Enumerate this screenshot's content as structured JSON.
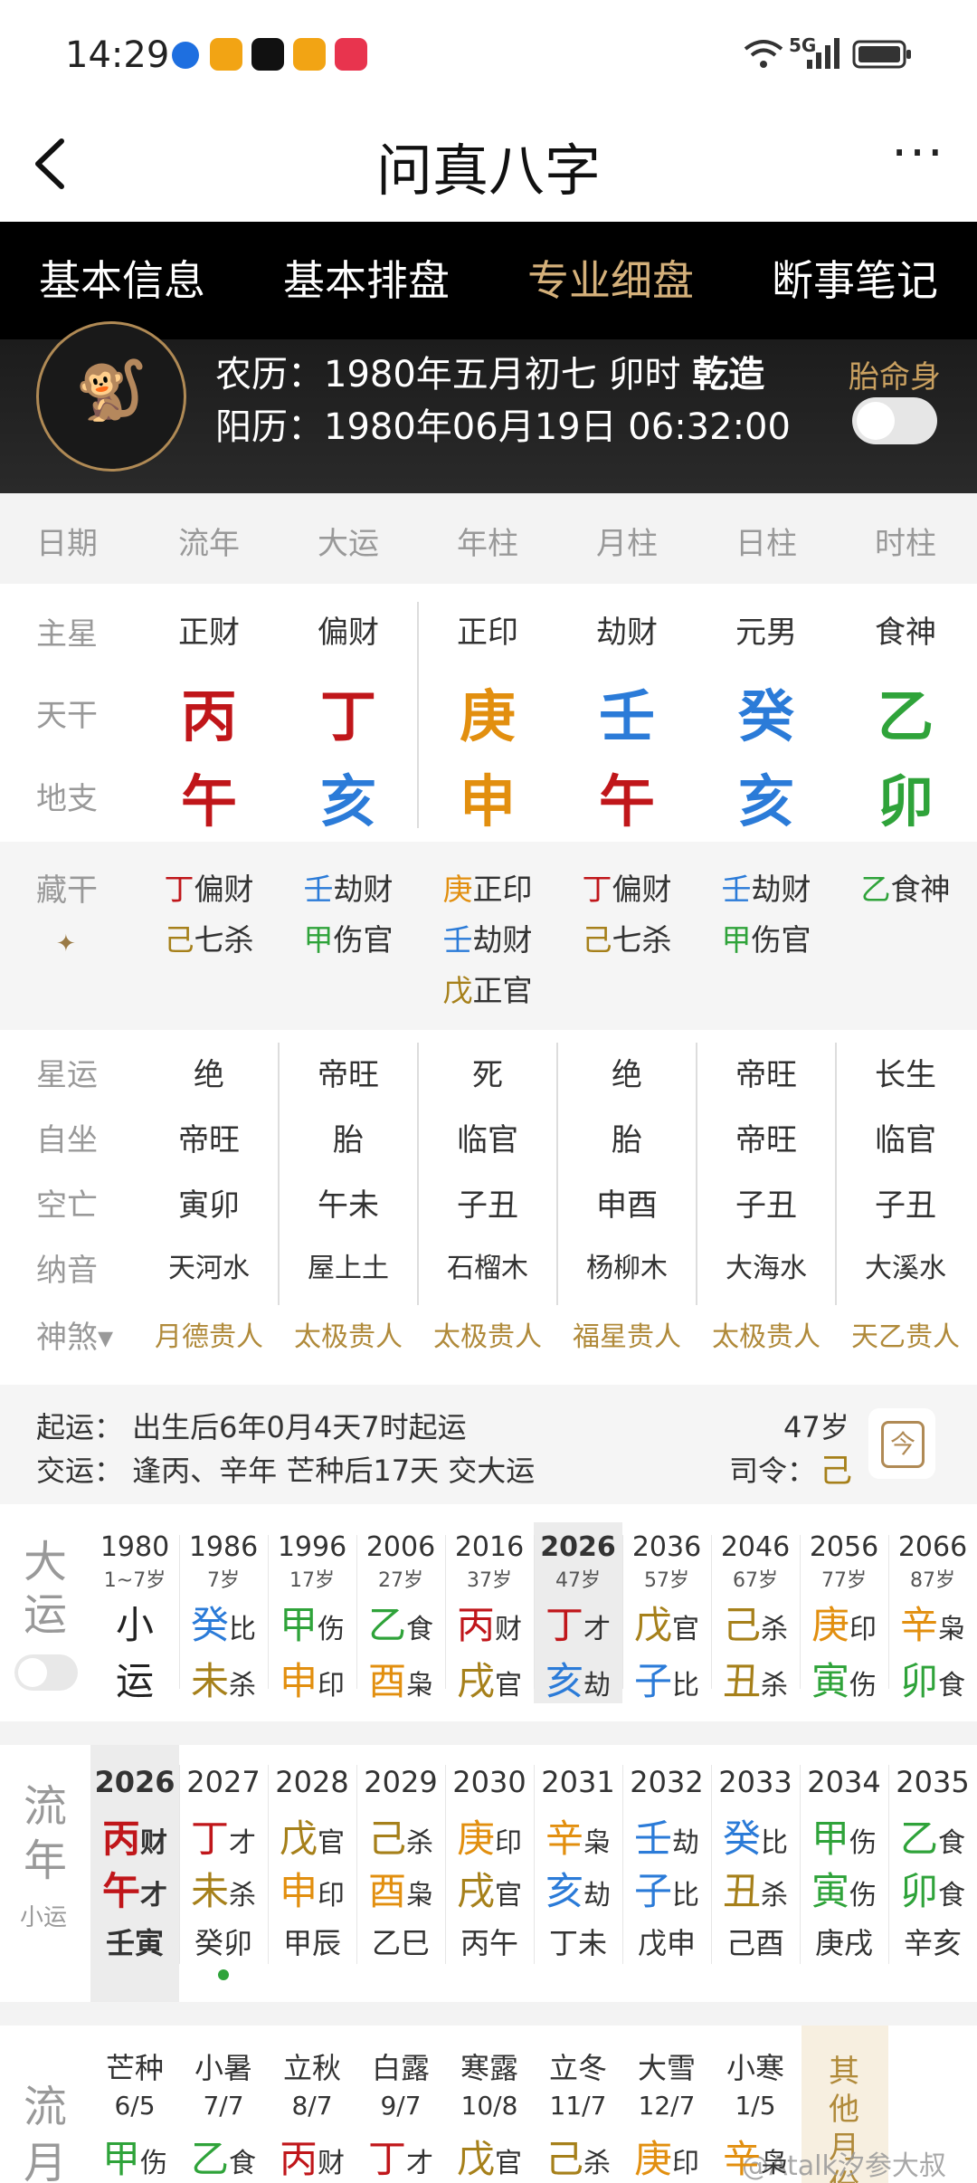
{
  "status": {
    "time": "14:29",
    "network": "5G"
  },
  "header": {
    "title": "问真八字",
    "more": "···"
  },
  "tabs": [
    {
      "label": "基本信息",
      "active": false
    },
    {
      "label": "基本排盘",
      "active": false
    },
    {
      "label": "专业细盘",
      "active": true
    },
    {
      "label": "断事笔记",
      "active": false
    }
  ],
  "profile": {
    "lunar_prefix": "农历：1980年五月初七 卯时 ",
    "lunar_gender": "乾造",
    "solar": "阳历：1980年06月19日 06:32:00",
    "taiming_label": "胎命身",
    "taiming_on": false
  },
  "columns": {
    "row_label": "日期",
    "headers": [
      "流年",
      "大运",
      "年柱",
      "月柱",
      "日柱",
      "时柱"
    ],
    "zhuxing_label": "主星",
    "zhuxing": [
      "正财",
      "偏财",
      "正印",
      "劫财",
      "元男",
      "食神"
    ],
    "tiangan_label": "天干",
    "tiangan": [
      "丙",
      "丁",
      "庚",
      "壬",
      "癸",
      "乙"
    ],
    "tiangan_colors": [
      "#c0161a",
      "#c0161a",
      "#e28f0f",
      "#2b7bd8",
      "#2b7bd8",
      "#2fa33a"
    ],
    "dizhi_label": "地支",
    "dizhi": [
      "午",
      "亥",
      "申",
      "午",
      "亥",
      "卯"
    ],
    "dizhi_colors": [
      "#c0161a",
      "#2b7bd8",
      "#e28f0f",
      "#c0161a",
      "#2b7bd8",
      "#2fa33a"
    ]
  },
  "canggan": {
    "label": "藏干",
    "cols": [
      [
        {
          "g": "丁",
          "s": "偏财",
          "c": "#c0161a"
        },
        {
          "g": "己",
          "s": "七杀",
          "c": "#a6801a"
        }
      ],
      [
        {
          "g": "壬",
          "s": "劫财",
          "c": "#2b7bd8"
        },
        {
          "g": "甲",
          "s": "伤官",
          "c": "#2fa33a"
        }
      ],
      [
        {
          "g": "庚",
          "s": "正印",
          "c": "#e28f0f"
        },
        {
          "g": "壬",
          "s": "劫财",
          "c": "#2b7bd8"
        },
        {
          "g": "戊",
          "s": "正官",
          "c": "#a6801a"
        }
      ],
      [
        {
          "g": "丁",
          "s": "偏财",
          "c": "#c0161a"
        },
        {
          "g": "己",
          "s": "七杀",
          "c": "#a6801a"
        }
      ],
      [
        {
          "g": "壬",
          "s": "劫财",
          "c": "#2b7bd8"
        },
        {
          "g": "甲",
          "s": "伤官",
          "c": "#2fa33a"
        }
      ],
      [
        {
          "g": "乙",
          "s": "食神",
          "c": "#2fa33a"
        }
      ]
    ]
  },
  "misc_rows": [
    {
      "label": "星运",
      "values": [
        "绝",
        "帝旺",
        "死",
        "绝",
        "帝旺",
        "长生"
      ]
    },
    {
      "label": "自坐",
      "values": [
        "帝旺",
        "胎",
        "临官",
        "胎",
        "帝旺",
        "临官"
      ]
    },
    {
      "label": "空亡",
      "values": [
        "寅卯",
        "午未",
        "子丑",
        "申酉",
        "子丑",
        "子丑"
      ]
    },
    {
      "label": "纳音",
      "values": [
        "天河水",
        "屋上土",
        "石榴木",
        "杨柳木",
        "大海水",
        "大溪水"
      ]
    }
  ],
  "shensha": {
    "label": "神煞▾",
    "values": [
      "月德贵人",
      "太极贵人",
      "太极贵人",
      "福星贵人",
      "太极贵人",
      "天乙贵人"
    ]
  },
  "qiyun": {
    "line1": "起运：  出生后6年0月4天7时起运",
    "line2": "交运：  逢丙、辛年 芒种后17天 交大运",
    "age": "47岁",
    "siling_label": "司令：",
    "siling_value": "己",
    "cal_char": "今"
  },
  "dayun": {
    "label_top": "大",
    "label_bottom": "运",
    "items": [
      {
        "year": "1980",
        "age": "1~7岁",
        "g": "小",
        "gs": "",
        "gc": "#222",
        "z": "运",
        "zs": "",
        "zc": "#222"
      },
      {
        "year": "1986",
        "age": "7岁",
        "g": "癸",
        "gs": "比",
        "gc": "#2b7bd8",
        "z": "未",
        "zs": "杀",
        "zc": "#a6801a"
      },
      {
        "year": "1996",
        "age": "17岁",
        "g": "甲",
        "gs": "伤",
        "gc": "#2fa33a",
        "z": "申",
        "zs": "印",
        "zc": "#e28f0f"
      },
      {
        "year": "2006",
        "age": "27岁",
        "g": "乙",
        "gs": "食",
        "gc": "#2fa33a",
        "z": "酉",
        "zs": "枭",
        "zc": "#e28f0f"
      },
      {
        "year": "2016",
        "age": "37岁",
        "g": "丙",
        "gs": "财",
        "gc": "#c0161a",
        "z": "戌",
        "zs": "官",
        "zc": "#a6801a"
      },
      {
        "year": "2026",
        "age": "47岁",
        "g": "丁",
        "gs": "才",
        "gc": "#c0161a",
        "z": "亥",
        "zs": "劫",
        "zc": "#2b7bd8",
        "current": true
      },
      {
        "year": "2036",
        "age": "57岁",
        "g": "戊",
        "gs": "官",
        "gc": "#a6801a",
        "z": "子",
        "zs": "比",
        "zc": "#2b7bd8"
      },
      {
        "year": "2046",
        "age": "67岁",
        "g": "己",
        "gs": "杀",
        "gc": "#a6801a",
        "z": "丑",
        "zs": "杀",
        "zc": "#a6801a"
      },
      {
        "year": "2056",
        "age": "77岁",
        "g": "庚",
        "gs": "印",
        "gc": "#e28f0f",
        "z": "寅",
        "zs": "伤",
        "zc": "#2fa33a"
      },
      {
        "year": "2066",
        "age": "87岁",
        "g": "辛",
        "gs": "枭",
        "gc": "#e28f0f",
        "z": "卯",
        "zs": "食",
        "zc": "#2fa33a"
      }
    ]
  },
  "liunian": {
    "label_top": "流",
    "label_bottom": "年",
    "label_small": "小运",
    "items": [
      {
        "year": "2026",
        "g": "丙",
        "gs": "财",
        "gc": "#c0161a",
        "z": "午",
        "zs": "才",
        "zc": "#c0161a",
        "xy": "壬寅",
        "current": true
      },
      {
        "year": "2027",
        "g": "丁",
        "gs": "才",
        "gc": "#c0161a",
        "z": "未",
        "zs": "杀",
        "zc": "#a6801a",
        "xy": "癸卯"
      },
      {
        "year": "2028",
        "g": "戊",
        "gs": "官",
        "gc": "#a6801a",
        "z": "申",
        "zs": "印",
        "zc": "#e28f0f",
        "xy": "甲辰"
      },
      {
        "year": "2029",
        "g": "己",
        "gs": "杀",
        "gc": "#a6801a",
        "z": "酉",
        "zs": "枭",
        "zc": "#e28f0f",
        "xy": "乙巳"
      },
      {
        "year": "2030",
        "g": "庚",
        "gs": "印",
        "gc": "#e28f0f",
        "z": "戌",
        "zs": "官",
        "zc": "#a6801a",
        "xy": "丙午"
      },
      {
        "year": "2031",
        "g": "辛",
        "gs": "枭",
        "gc": "#e28f0f",
        "z": "亥",
        "zs": "劫",
        "zc": "#2b7bd8",
        "xy": "丁未"
      },
      {
        "year": "2032",
        "g": "壬",
        "gs": "劫",
        "gc": "#2b7bd8",
        "z": "子",
        "zs": "比",
        "zc": "#2b7bd8",
        "xy": "戊申"
      },
      {
        "year": "2033",
        "g": "癸",
        "gs": "比",
        "gc": "#2b7bd8",
        "z": "丑",
        "zs": "杀",
        "zc": "#a6801a",
        "xy": "己酉"
      },
      {
        "year": "2034",
        "g": "甲",
        "gs": "伤",
        "gc": "#2fa33a",
        "z": "寅",
        "zs": "伤",
        "zc": "#2fa33a",
        "xy": "庚戌"
      },
      {
        "year": "2035",
        "g": "乙",
        "gs": "食",
        "gc": "#2fa33a",
        "z": "卯",
        "zs": "食",
        "zc": "#2fa33a",
        "xy": "辛亥"
      }
    ]
  },
  "liuyue": {
    "label_top": "流",
    "label_bottom": "月",
    "items": [
      {
        "jq": "芒种",
        "date": "6/5",
        "g": "甲",
        "gs": "伤",
        "gc": "#2fa33a"
      },
      {
        "jq": "小暑",
        "date": "7/7",
        "g": "乙",
        "gs": "食",
        "gc": "#2fa33a"
      },
      {
        "jq": "立秋",
        "date": "8/7",
        "g": "丙",
        "gs": "财",
        "gc": "#c0161a"
      },
      {
        "jq": "白露",
        "date": "9/7",
        "g": "丁",
        "gs": "才",
        "gc": "#c0161a"
      },
      {
        "jq": "寒露",
        "date": "10/8",
        "g": "戊",
        "gs": "官",
        "gc": "#a6801a"
      },
      {
        "jq": "立冬",
        "date": "11/7",
        "g": "己",
        "gs": "杀",
        "gc": "#a6801a"
      },
      {
        "jq": "大雪",
        "date": "12/7",
        "g": "庚",
        "gs": "印",
        "gc": "#e28f0f"
      },
      {
        "jq": "小寒",
        "date": "1/5",
        "g": "辛",
        "gs": "枭",
        "gc": "#e28f0f"
      }
    ],
    "other": "其他月份"
  },
  "watermark": "@Atalk汐参大叔"
}
